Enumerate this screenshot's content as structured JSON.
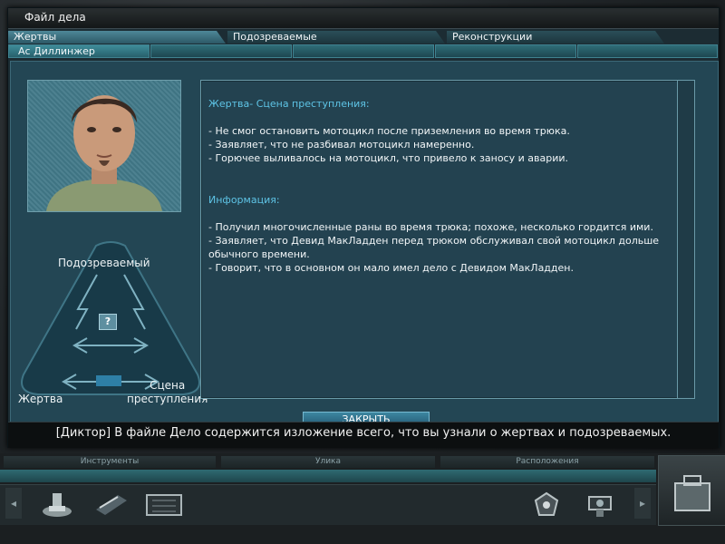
{
  "window": {
    "title": "Файл дела"
  },
  "tabs": [
    "Жертвы",
    "Подозреваемые",
    "Реконструкции"
  ],
  "subtabs": [
    "Ас Диллинжер"
  ],
  "triangle": {
    "suspect_label": "Подозреваемый",
    "victim_label": "Жертва",
    "scene_label": "Сцена\nпреступления",
    "center_icon": "question-mark-icon"
  },
  "text": {
    "heading1": "Жертва- Сцена преступления:",
    "lines1": " - Не смог остановить мотоцикл после приземления во время трюка.\n - Заявляет, что не разбивал мотоцикл намеренно.\n - Горючее выливалось на мотоцикл, что привело к заносу и аварии.",
    "heading2": "Информация:",
    "lines2": " - Получил многочисленные раны во время трюка; похоже, несколько гордится ими.\n - Заявляет, что Девид МакЛадден перед трюком обслуживал свой мотоцикл дольше\n   обычного времени.\n - Говорит, что в основном он мало имел дело с Девидом МакЛадден."
  },
  "close_button": "ЗАКРЫТЬ",
  "subtitle": "[Диктор] В файле Дело содержится изложение всего, что вы узнали о жертвах и подозреваемых.",
  "hud": {
    "headers": [
      "Инструменты",
      "Улика",
      "Расположения"
    ],
    "left_arrow": "◂",
    "right_arrow": "▸",
    "tool_icons": [
      "brush-kit-icon",
      "tape-roll-icon",
      "evidence-case-icon"
    ],
    "location_icons": [
      "badge-icon",
      "camera-icon"
    ],
    "case_icon": "case-file-icon"
  },
  "colors": {
    "accent": "#5ec4e6",
    "panel": "#234654",
    "tab": "#3b6b78"
  }
}
